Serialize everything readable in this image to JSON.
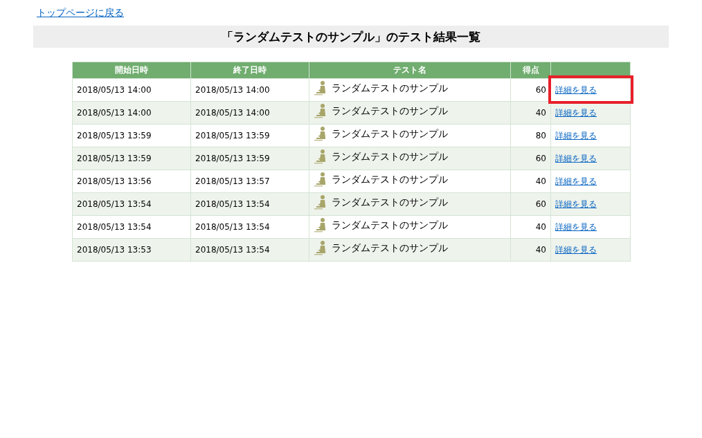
{
  "back_link": "トップページに戻る",
  "title": "「ランダムテストのサンプル」のテスト結果一覧",
  "table": {
    "columns": [
      "開始日時",
      "終了日時",
      "テスト名",
      "得点"
    ],
    "rows": [
      {
        "start": "2018/05/13 14:00",
        "end": "2018/05/13 14:00",
        "test": "ランダムテストのサンプル",
        "score": "60",
        "link": "詳細を見る",
        "highlighted": true
      },
      {
        "start": "2018/05/13 14:00",
        "end": "2018/05/13 14:00",
        "test": "ランダムテストのサンプル",
        "score": "40",
        "link": "詳細を見る",
        "highlighted": false
      },
      {
        "start": "2018/05/13 13:59",
        "end": "2018/05/13 13:59",
        "test": "ランダムテストのサンプル",
        "score": "80",
        "link": "詳細を見る",
        "highlighted": false
      },
      {
        "start": "2018/05/13 13:59",
        "end": "2018/05/13 13:59",
        "test": "ランダムテストのサンプル",
        "score": "60",
        "link": "詳細を見る",
        "highlighted": false
      },
      {
        "start": "2018/05/13 13:56",
        "end": "2018/05/13 13:57",
        "test": "ランダムテストのサンプル",
        "score": "40",
        "link": "詳細を見る",
        "highlighted": false
      },
      {
        "start": "2018/05/13 13:54",
        "end": "2018/05/13 13:54",
        "test": "ランダムテストのサンプル",
        "score": "60",
        "link": "詳細を見る",
        "highlighted": false
      },
      {
        "start": "2018/05/13 13:54",
        "end": "2018/05/13 13:54",
        "test": "ランダムテストのサンプル",
        "score": "40",
        "link": "詳細を見る",
        "highlighted": false
      },
      {
        "start": "2018/05/13 13:53",
        "end": "2018/05/13 13:54",
        "test": "ランダムテストのサンプル",
        "score": "40",
        "link": "詳細を見る",
        "highlighted": false
      }
    ]
  }
}
